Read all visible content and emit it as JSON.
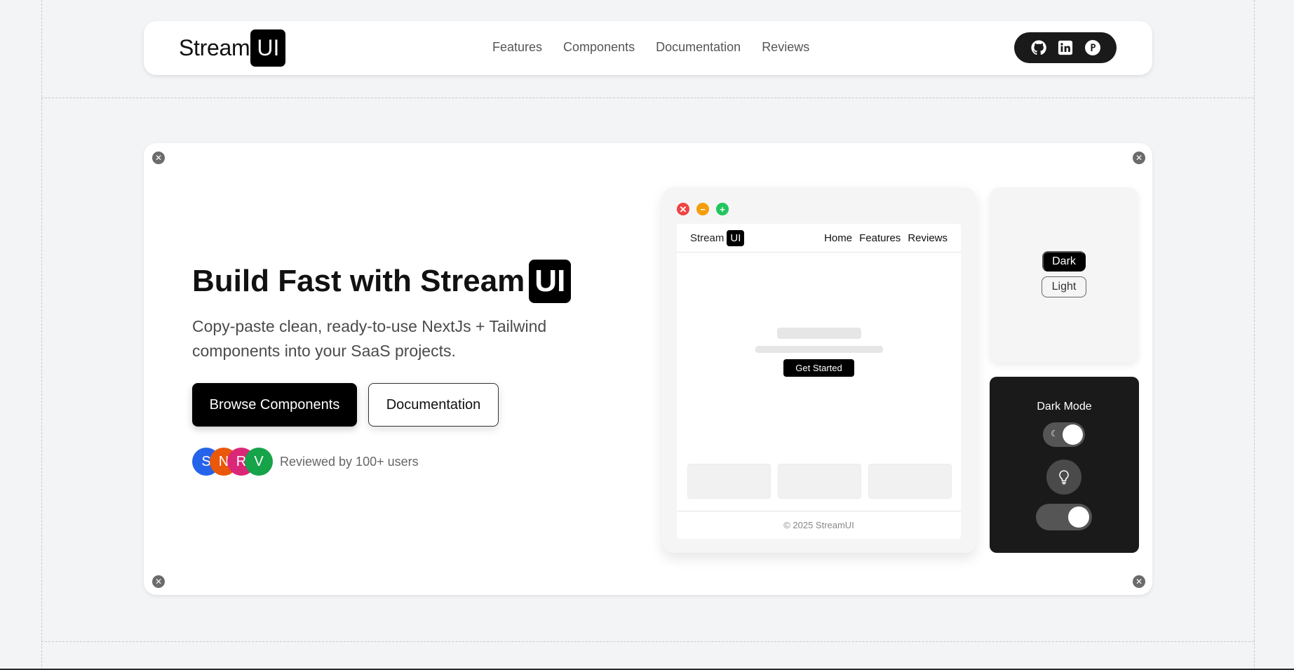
{
  "navbar": {
    "logo_text": "Stream",
    "logo_badge": "UI",
    "links": [
      "Features",
      "Components",
      "Documentation",
      "Reviews"
    ],
    "social_icons": [
      "github-icon",
      "linkedin-icon",
      "producthunt-icon"
    ]
  },
  "hero": {
    "title_text": "Build Fast with Stream",
    "title_badge": "UI",
    "subtitle": "Copy-paste clean, ready-to-use NextJs + Tailwind components into your SaaS projects.",
    "primary_button": "Browse Components",
    "secondary_button": "Documentation",
    "avatars": [
      {
        "letter": "S",
        "color": "#2563eb"
      },
      {
        "letter": "N",
        "color": "#ea580c"
      },
      {
        "letter": "R",
        "color": "#db2777"
      },
      {
        "letter": "V",
        "color": "#16a34a"
      }
    ],
    "reviews_text": "Reviewed by 100+ users"
  },
  "browser_mock": {
    "traffic_lights": [
      {
        "symbol": "✕",
        "color": "#ef4444"
      },
      {
        "symbol": "−",
        "color": "#f59e0b"
      },
      {
        "symbol": "+",
        "color": "#22c55e"
      }
    ],
    "logo_text": "Stream",
    "logo_badge": "UI",
    "links": [
      "Home",
      "Features",
      "Reviews"
    ],
    "cta": "Get Started",
    "footer": "© 2025 StreamUI"
  },
  "theme_card": {
    "dark_label": "Dark",
    "light_label": "Light"
  },
  "dark_mode_card": {
    "title": "Dark Mode",
    "toggle_icon": "☾"
  },
  "colors": {
    "background": "#f3f4f6",
    "accent": "#000000",
    "dark_card": "#1a1a1a"
  }
}
